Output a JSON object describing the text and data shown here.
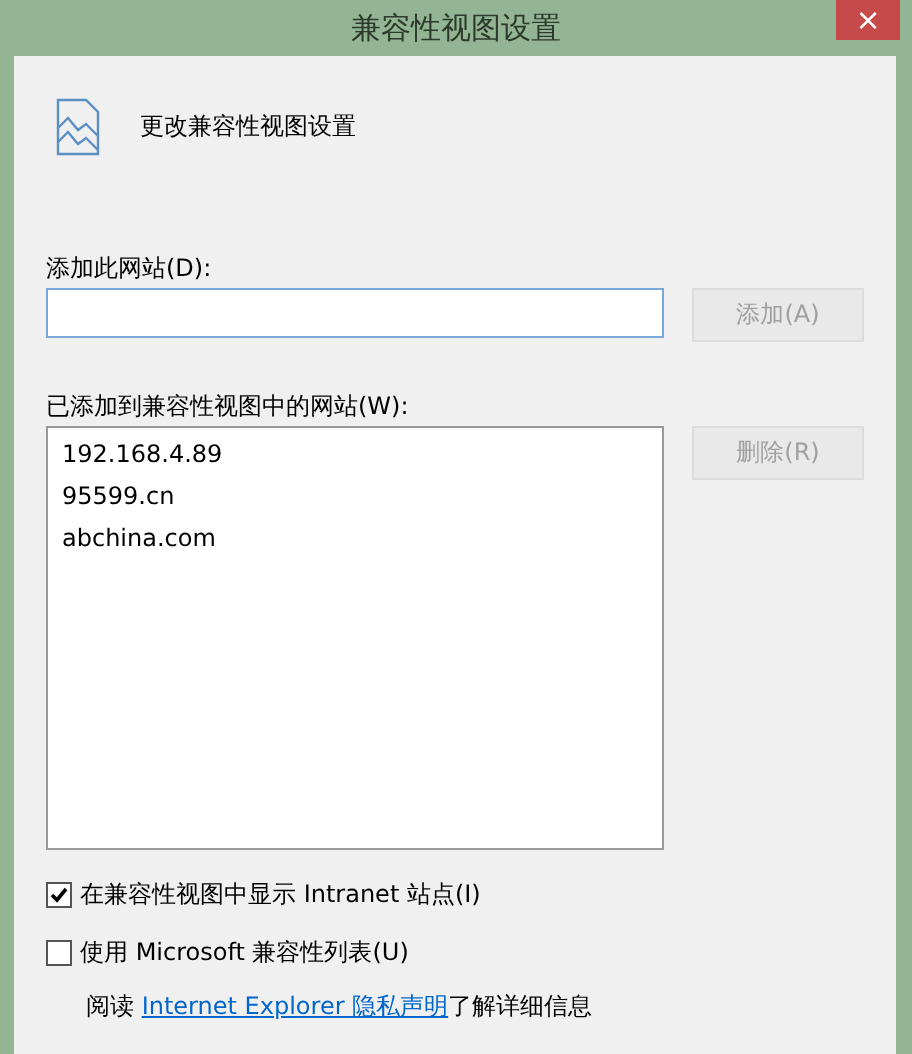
{
  "window": {
    "title": "兼容性视图设置",
    "close": "×"
  },
  "header": {
    "text": "更改兼容性视图设置"
  },
  "add_site": {
    "label": "添加此网站(D):",
    "button": {
      "label": "添加(A)",
      "disabled": true
    }
  },
  "site_list": {
    "label": "已添加到兼容性视图中的网站(W):",
    "items": [
      {
        "text": "192.168.4.89",
        "selected": false
      },
      {
        "text": "95599.cn",
        "selected": false
      },
      {
        "text": "abchina.com",
        "selected": false
      }
    ],
    "button": {
      "label": "删除(R)",
      "disabled": true
    }
  },
  "options": [
    {
      "label": "在兼容性视图中显示 Intranet 站点(I)",
      "checked": true
    },
    {
      "label": "使用 Microsoft 兼容性列表(U)",
      "checked": false
    }
  ],
  "privacy_note": {
    "prefix": "阅读 ",
    "link": "Internet Explorer 隐私声明",
    "suffix": "了解详细信息"
  }
}
